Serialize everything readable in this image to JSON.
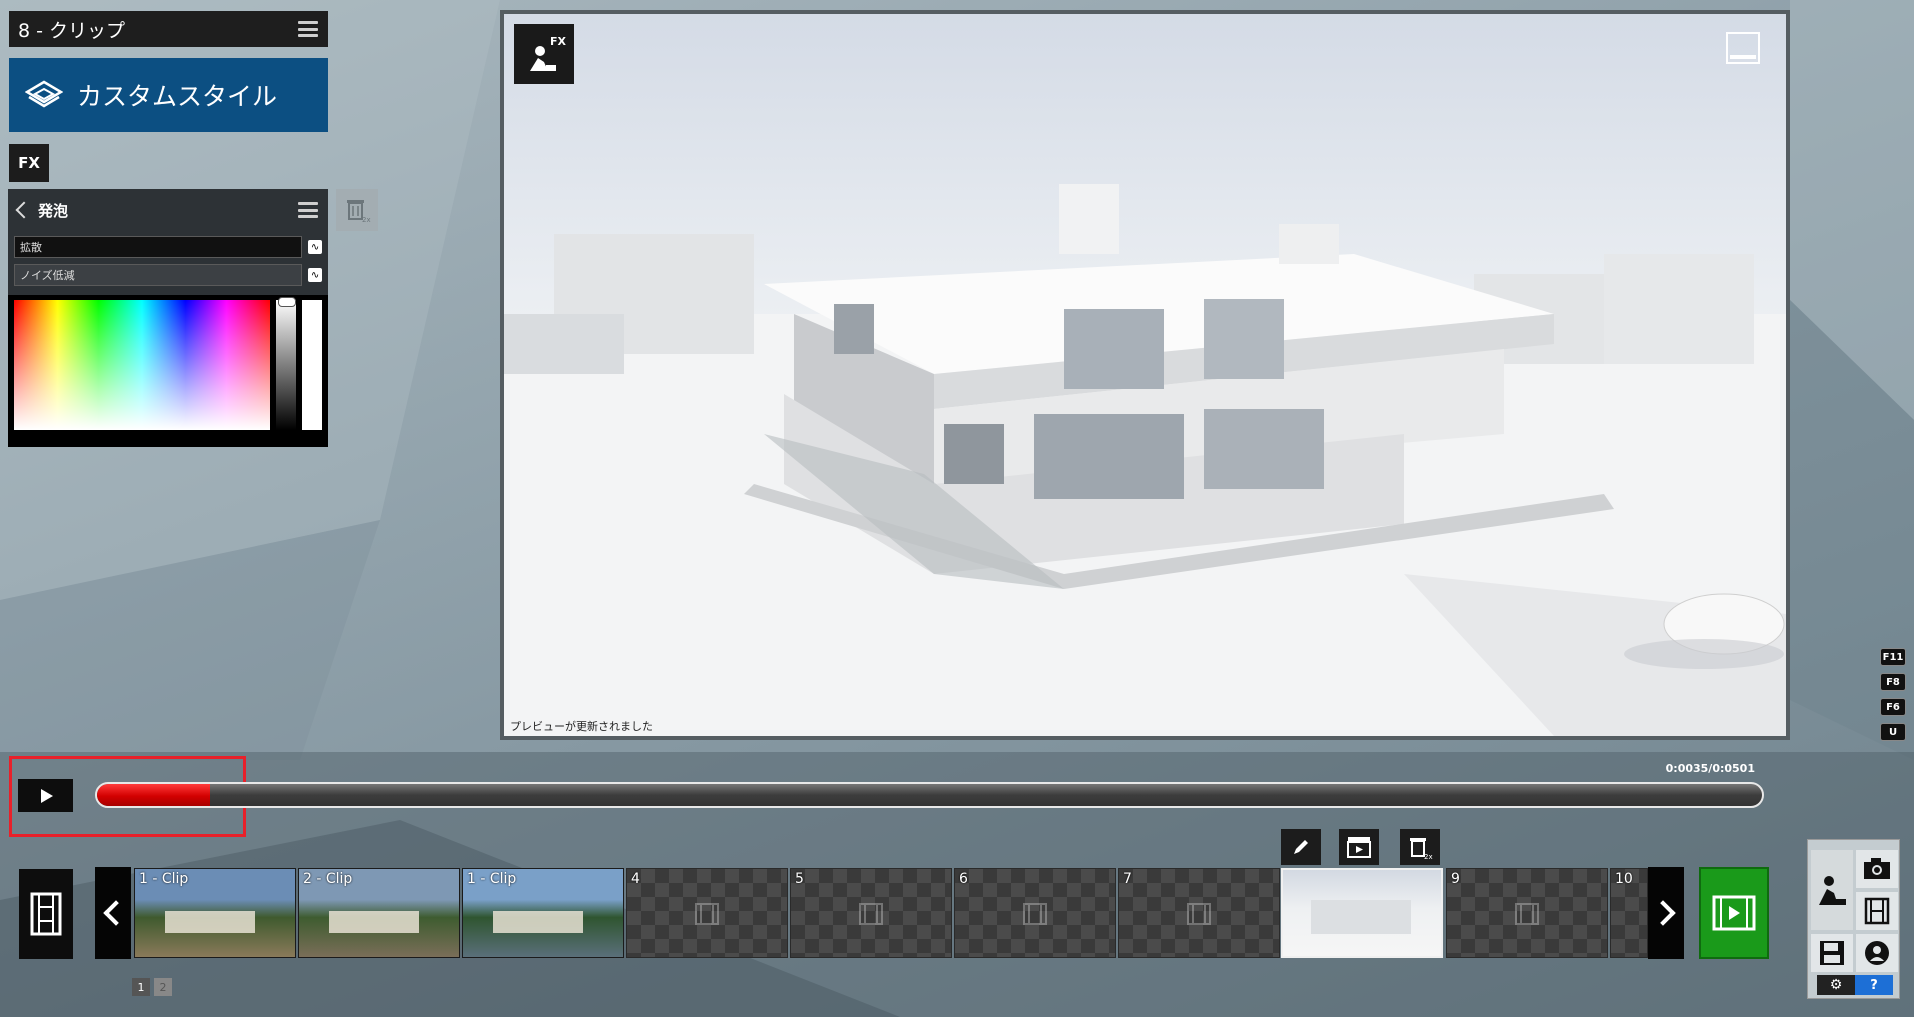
{
  "clip_header": {
    "title": "8 - クリップ"
  },
  "style_button": {
    "label": "カスタムスタイル"
  },
  "fx_tab": {
    "label": "FX"
  },
  "effect": {
    "title": "発泡",
    "params": [
      {
        "label": "拡散"
      },
      {
        "label": "ノイズ低減"
      }
    ]
  },
  "trash_side": {
    "badge": "2x"
  },
  "viewport": {
    "fx_badge": "FX",
    "status": "プレビューが更新されました"
  },
  "shortcuts": [
    "F11",
    "F8",
    "F6",
    "U"
  ],
  "playback": {
    "time": "0:0035/0:0501",
    "progress_fraction": 0.068
  },
  "clips": [
    {
      "label": "1 - Clip",
      "state": "filled"
    },
    {
      "label": "2 - Clip",
      "state": "filled"
    },
    {
      "label": "1 - Clip",
      "state": "filled"
    },
    {
      "label": "4",
      "state": "empty"
    },
    {
      "label": "5",
      "state": "empty"
    },
    {
      "label": "6",
      "state": "empty"
    },
    {
      "label": "7",
      "state": "empty"
    },
    {
      "label": "",
      "state": "selected"
    },
    {
      "label": "9",
      "state": "empty"
    },
    {
      "label": "10",
      "state": "empty"
    }
  ],
  "pages": [
    "1",
    "2"
  ],
  "mode_panel": {
    "help": "?"
  },
  "colors": {
    "accent_blue": "#0c4f82",
    "progress_red": "#d30000",
    "render_green": "#1a9a1a",
    "highlight_red": "#e8202a",
    "help_blue": "#1d6fd6"
  }
}
